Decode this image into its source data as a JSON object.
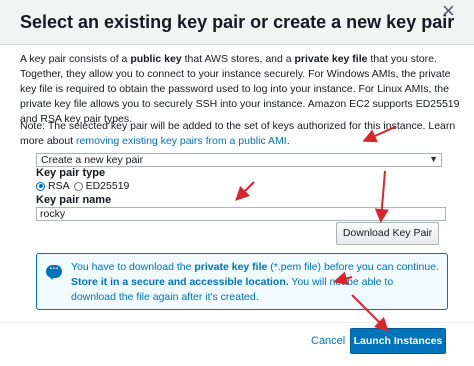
{
  "dialog": {
    "title": "Select an existing key pair or create a new key pair",
    "close_glyph": "×"
  },
  "description": {
    "part1": "A key pair consists of a ",
    "bold1": "public key",
    "part2": " that AWS stores, and a ",
    "bold2": "private key file",
    "part3": " that you store. Together, they allow you to connect to your instance securely. For Windows AMIs, the private key file is required to obtain the password used to log into your instance. For Linux AMIs, the private key file allows you to securely SSH into your instance. Amazon EC2 supports ED25519 and RSA key pair types."
  },
  "note": {
    "text": "Note: The selected key pair will be added to the set of keys authorized for this instance. Learn more about ",
    "link": "removing existing key pairs from a public AMI",
    "suffix": "."
  },
  "key_pair_select": {
    "value": "Create a new key pair",
    "chevron": "▼"
  },
  "key_pair_type": {
    "label": "Key pair type",
    "options": [
      {
        "label": "RSA",
        "selected": true
      },
      {
        "label": "ED25519",
        "selected": false
      }
    ]
  },
  "key_pair_name": {
    "label": "Key pair name",
    "value": "rocky"
  },
  "download_button": {
    "label": "Download Key Pair"
  },
  "info_box": {
    "part1": "You have to download the ",
    "bold1": "private key file",
    "part2": " (*.pem file) before you can continue. ",
    "bold2": "Store it in a secure and accessible location.",
    "part3": " You will not be able to download the file again after it's created."
  },
  "footer": {
    "cancel_label": "Cancel",
    "launch_label": "Launch Instances"
  },
  "colors": {
    "accent": "#0073bb",
    "annotation_arrow": "#d9262c",
    "header_bg": "#f2f3f3",
    "info_bg": "#f1faff"
  }
}
